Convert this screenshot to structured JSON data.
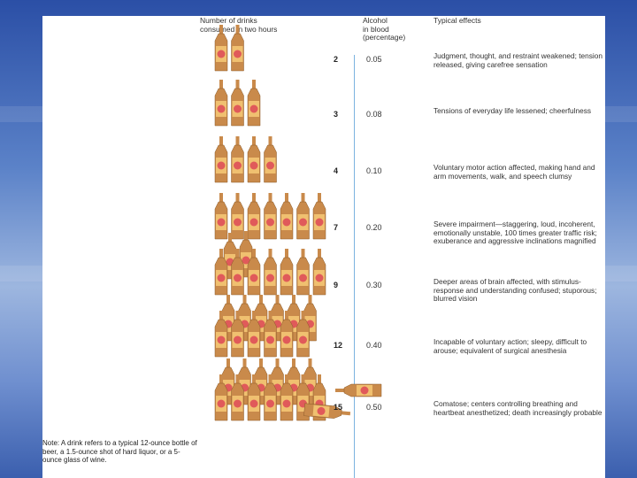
{
  "header": {
    "drinks": "Number of drinks\nconsumed in two hours",
    "alcohol": "Alcohol\nin blood\n(percentage)",
    "effects": "Typical effects"
  },
  "rows": [
    {
      "num": "2",
      "pct": "0.05",
      "effect": "Judgment, thought, and restraint weakened; tension released, giving carefree sensation",
      "bottles": 2
    },
    {
      "num": "3",
      "pct": "0.08",
      "effect": "Tensions of everyday life lessened; cheerfulness",
      "bottles": 3
    },
    {
      "num": "4",
      "pct": "0.10",
      "effect": "Voluntary motor action affected, making hand and arm movements, walk, and speech clumsy",
      "bottles": 4
    },
    {
      "num": "7",
      "pct": "0.20",
      "effect": "Severe impairment—staggering, loud, incoherent, emotionally unstable, 100 times greater traffic risk; exuberance and aggressive inclinations magnified",
      "bottles": 7
    },
    {
      "num": "9",
      "pct": "0.30",
      "effect": "Deeper areas of brain affected, with stimulus-response and understanding confused; stuporous; blurred vision",
      "bottles": 9
    },
    {
      "num": "12",
      "pct": "0.40",
      "effect": "Incapable of voluntary action; sleepy, difficult to arouse; equivalent of surgical anesthesia",
      "bottles": 12
    },
    {
      "num": "15",
      "pct": "0.50",
      "effect": "Comatose; centers controlling breathing and heartbeat anesthetized; death increasingly probable",
      "bottles": 15
    }
  ],
  "note": "Note: A drink refers to a typical 12-ounce bottle of beer, a 1.5-ounce shot of hard liquor, or a 5-ounce glass of wine.",
  "colors": {
    "bottle": "#c98a4b",
    "label": "#f0c070",
    "seal": "#e05a5a",
    "rule": "#7bb3df"
  }
}
